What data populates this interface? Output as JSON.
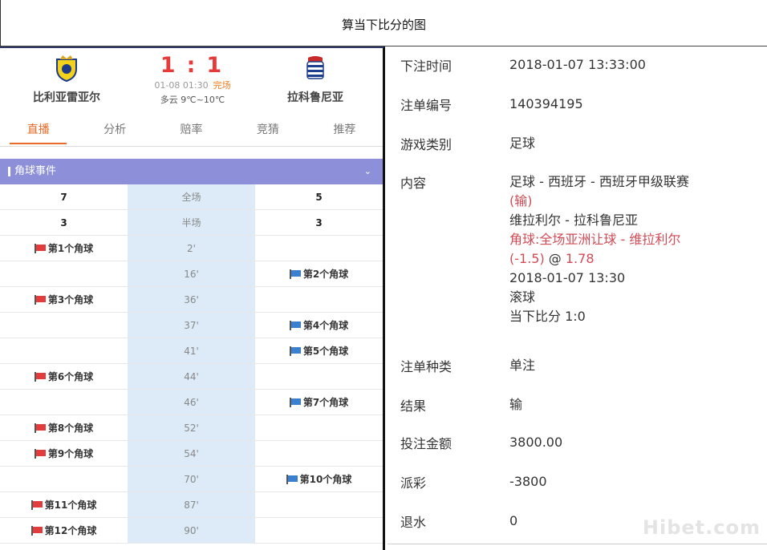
{
  "page_title": "算当下比分的图",
  "match": {
    "home_team": "比利亚雷亚尔",
    "away_team": "拉科鲁尼亚",
    "home_score": "1",
    "away_score": "1",
    "separator": ":",
    "datetime": "01-08 01:30",
    "status": "完场",
    "weather": "多云 9℃~10℃"
  },
  "tabs": [
    {
      "label": "直播"
    },
    {
      "label": "分析"
    },
    {
      "label": "赔率"
    },
    {
      "label": "竞猜"
    },
    {
      "label": "推荐"
    }
  ],
  "corner_section": {
    "title": "角球事件",
    "summary": [
      {
        "home": "7",
        "label": "全场",
        "away": "5"
      },
      {
        "home": "3",
        "label": "半场",
        "away": "3"
      }
    ],
    "events": [
      {
        "minute": "2'",
        "home": "第1个角球",
        "away": ""
      },
      {
        "minute": "16'",
        "home": "",
        "away": "第2个角球"
      },
      {
        "minute": "36'",
        "home": "第3个角球",
        "away": ""
      },
      {
        "minute": "37'",
        "home": "",
        "away": "第4个角球"
      },
      {
        "minute": "41'",
        "home": "",
        "away": "第5个角球"
      },
      {
        "minute": "44'",
        "home": "第6个角球",
        "away": ""
      },
      {
        "minute": "46'",
        "home": "",
        "away": "第7个角球"
      },
      {
        "minute": "52'",
        "home": "第8个角球",
        "away": ""
      },
      {
        "minute": "54'",
        "home": "第9个角球",
        "away": ""
      },
      {
        "minute": "70'",
        "home": "",
        "away": "第10个角球"
      },
      {
        "minute": "87'",
        "home": "第11个角球",
        "away": ""
      },
      {
        "minute": "90'",
        "home": "第12个角球",
        "away": ""
      }
    ]
  },
  "bet": {
    "time_label": "下注时间",
    "time_value": "2018-01-07 13:33:00",
    "id_label": "注单编号",
    "id_value": "140394195",
    "game_label": "游戏类别",
    "game_value": "足球",
    "content_label": "内容",
    "content_league": "足球 - 西班牙 - 西班牙甲级联赛",
    "content_result_tag": "(输)",
    "content_match": "维拉利尔 - 拉科鲁尼亚",
    "content_pick": "角球:全场亚洲让球 - 维拉利尔",
    "content_handicap": "(-1.5)",
    "content_at": " @ ",
    "content_odds": "1.78",
    "content_time": "2018-01-07 13:30",
    "content_type": "滚球",
    "content_score": "当下比分 1:0",
    "kind_label": "注单种类",
    "kind_value": "单注",
    "result_label": "结果",
    "result_value": "输",
    "amount_label": "投注金额",
    "amount_value": "3800.00",
    "payout_label": "派彩",
    "payout_value": "-3800",
    "rebate_label": "退水",
    "rebate_value": "0"
  },
  "watermark": "Hibet.com"
}
